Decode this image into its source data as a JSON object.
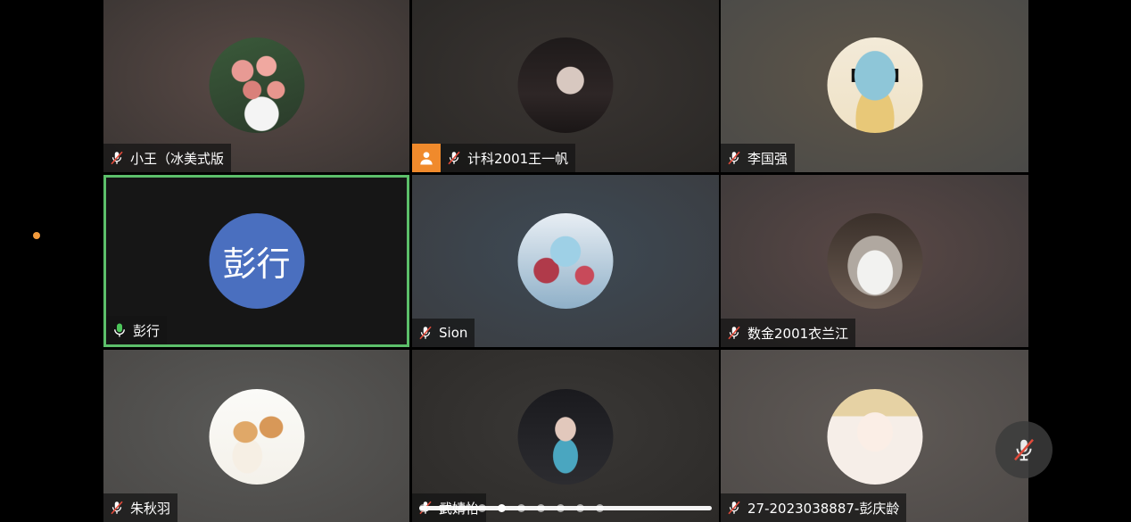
{
  "participants": [
    {
      "name": "小王（冰美式版",
      "mic": "muted",
      "host": false,
      "avatar_kind": "roses-photo",
      "bg": [
        "#5a4a46",
        "#3a3533"
      ]
    },
    {
      "name": "计科2001王一帆",
      "mic": "muted",
      "host": true,
      "avatar_kind": "girl-photo",
      "bg": [
        "#3a3532",
        "#2a2826"
      ]
    },
    {
      "name": "李国强",
      "mic": "muted",
      "host": false,
      "avatar_kind": "squirtle-sunglasses",
      "bg": [
        "#5e5548",
        "#4a4a48"
      ]
    },
    {
      "name": "彭行",
      "mic": "active",
      "host": false,
      "avatar_kind": "text",
      "avatar_text": "彭行",
      "active": true,
      "bg": [
        "#161616",
        "#161616"
      ]
    },
    {
      "name": "Sion",
      "mic": "muted",
      "host": false,
      "avatar_kind": "anime-art",
      "bg": [
        "#3e4a55",
        "#3a3c40"
      ]
    },
    {
      "name": "数金2001衣兰江",
      "mic": "muted",
      "host": false,
      "avatar_kind": "cat-photo",
      "bg": [
        "#5a4846",
        "#3e3a3a"
      ]
    },
    {
      "name": "朱秋羽",
      "mic": "muted",
      "host": false,
      "avatar_kind": "cats-drawing",
      "bg": [
        "#5a5a58",
        "#4a4846"
      ]
    },
    {
      "name": "武婧怡",
      "mic": "muted",
      "host": false,
      "avatar_kind": "girl-photo-dark",
      "bg": [
        "#3a3836",
        "#2c2a28"
      ]
    },
    {
      "name": "27-2023038887-彭庆龄",
      "mic": "muted",
      "host": false,
      "avatar_kind": "anime-boy",
      "bg": [
        "#605a56",
        "#4e4a48"
      ]
    }
  ],
  "colors": {
    "active_border": "#5cbf6a",
    "host_badge": "#f08a2c",
    "notification_dot": "#f29a3c",
    "text_avatar_bg": "#4a6fbf",
    "muted_slash": "#e04a3a"
  },
  "pager": {
    "page_count": 10,
    "current_page": 5
  },
  "controls": {
    "mic_icon": "muted-microphone-icon"
  }
}
